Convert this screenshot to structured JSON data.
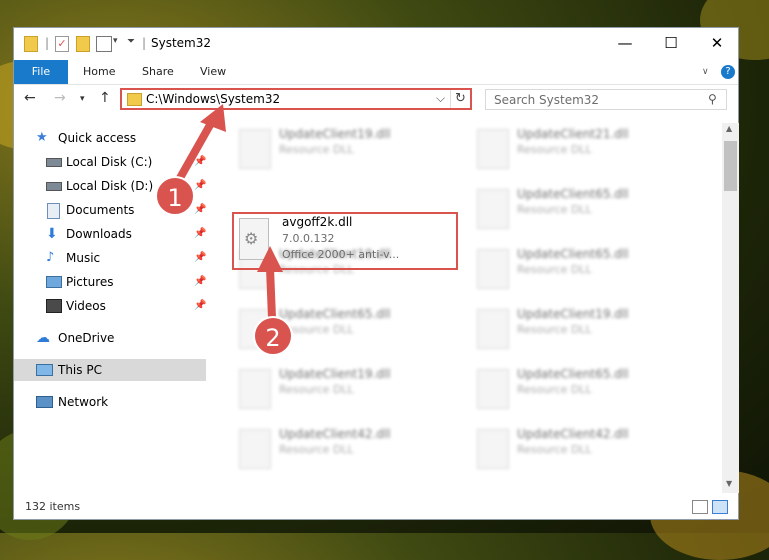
{
  "window": {
    "title": "System32",
    "minimize": "—",
    "maximize": "☐",
    "close": "✕"
  },
  "ribbon": {
    "tabs": [
      "File",
      "Home",
      "Share",
      "View"
    ],
    "help": "?"
  },
  "address": {
    "path": "C:\\Windows\\System32",
    "search_placeholder": "Search System32"
  },
  "sidebar": {
    "items": [
      {
        "label": "Quick access",
        "icon": "star-icon"
      },
      {
        "label": "Local Disk (C:)",
        "icon": "drive-icon",
        "pinned": true
      },
      {
        "label": "Local Disk (D:)",
        "icon": "drive-icon",
        "pinned": true
      },
      {
        "label": "Documents",
        "icon": "document-icon",
        "pinned": true
      },
      {
        "label": "Downloads",
        "icon": "download-icon",
        "pinned": true
      },
      {
        "label": "Music",
        "icon": "music-icon",
        "pinned": true
      },
      {
        "label": "Pictures",
        "icon": "pictures-icon",
        "pinned": true
      },
      {
        "label": "Videos",
        "icon": "video-icon",
        "pinned": true
      },
      {
        "label": "OneDrive",
        "icon": "cloud-icon"
      },
      {
        "label": "This PC",
        "icon": "computer-icon",
        "selected": true
      },
      {
        "label": "Network",
        "icon": "network-icon"
      }
    ]
  },
  "files": {
    "highlighted": {
      "name": "avgoff2k.dll",
      "version": "7.0.0.132",
      "desc": "Office 2000+ anti-v..."
    },
    "others": [
      {
        "name": "UpdateClient19.dll",
        "type": "Resource DLL"
      },
      {
        "name": "UpdateClient21.dll",
        "type": "Resource DLL"
      },
      {
        "name": "UpdateClient65.dll",
        "type": "Resource DLL"
      },
      {
        "name": "UpdateClient19.dll",
        "type": "Resource DLL"
      },
      {
        "name": "UpdateClient65.dll",
        "type": "Resource DLL"
      },
      {
        "name": "UpdateClient65.dll",
        "type": "Resource DLL"
      },
      {
        "name": "UpdateClient19.dll",
        "type": "Resource DLL"
      },
      {
        "name": "UpdateClient19.dll",
        "type": "Resource DLL"
      },
      {
        "name": "UpdateClient65.dll",
        "type": "Resource DLL"
      },
      {
        "name": "UpdateClient42.dll",
        "type": "Resource DLL"
      },
      {
        "name": "UpdateClient42.dll",
        "type": "Resource DLL"
      }
    ]
  },
  "status": {
    "items": "132 items"
  },
  "callouts": [
    "1",
    "2"
  ],
  "colors": {
    "accent": "#1979ca",
    "highlight": "#d9534f"
  }
}
